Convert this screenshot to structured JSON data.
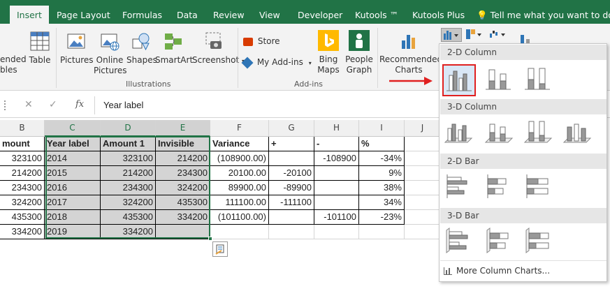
{
  "tabs": [
    {
      "label": "Insert",
      "active": true
    },
    {
      "label": "Page Layout"
    },
    {
      "label": "Formulas"
    },
    {
      "label": "Data"
    },
    {
      "label": "Review"
    },
    {
      "label": "View"
    },
    {
      "label": "Developer"
    },
    {
      "label": "Kutools ™"
    },
    {
      "label": "Kutools Plus"
    }
  ],
  "tell_me": "Tell me what you want to do...",
  "ribbon": {
    "tables_partial_1": "ended",
    "tables_partial_2": "bles",
    "table": "Table",
    "pictures": "Pictures",
    "online_1": "Online",
    "online_2": "Pictures",
    "shapes": "Shapes",
    "smartart": "SmartArt",
    "screenshot": "Screenshot",
    "illustrations": "Illustrations",
    "store": "Store",
    "my_addins": "My Add-ins",
    "bing_1": "Bing",
    "bing_2": "Maps",
    "people_1": "People",
    "people_2": "Graph",
    "addins": "Add-ins",
    "rec_1": "Recommended",
    "rec_2": "Charts"
  },
  "formula_bar": {
    "cancel": "✕",
    "enter": "✓",
    "fx": "fx",
    "value": "Year label"
  },
  "columns": [
    "B",
    "C",
    "D",
    "E",
    "F",
    "G",
    "H",
    "I",
    "J"
  ],
  "headers": [
    "mount",
    "Year label",
    "Amount 1",
    "Invisible",
    "Variance",
    "+",
    "-",
    "%"
  ],
  "rows": [
    [
      "323100",
      "2014",
      "323100",
      "214200",
      "(108900.00)",
      "",
      "-108900",
      "-34%"
    ],
    [
      "214200",
      "2015",
      "214200",
      "234300",
      "20100.00",
      "-20100",
      "",
      "9%"
    ],
    [
      "234300",
      "2016",
      "234300",
      "324200",
      "89900.00",
      "-89900",
      "",
      "38%"
    ],
    [
      "324200",
      "2017",
      "324200",
      "435300",
      "111100.00",
      "-111100",
      "",
      "34%"
    ],
    [
      "435300",
      "2018",
      "435300",
      "334200",
      "(101100.00)",
      "",
      "-101100",
      "-23%"
    ],
    [
      "334200",
      "2019",
      "334200",
      "",
      "",
      "",
      "",
      ""
    ]
  ],
  "dropdown": {
    "sec1": "2-D Column",
    "sec2": "3-D Column",
    "sec3": "2-D Bar",
    "sec4": "3-D Bar",
    "more": "More Column Charts..."
  },
  "colors": {
    "excel_green": "#217346",
    "highlight_red": "#e02020",
    "selection_fill": "#d4d4d4"
  }
}
